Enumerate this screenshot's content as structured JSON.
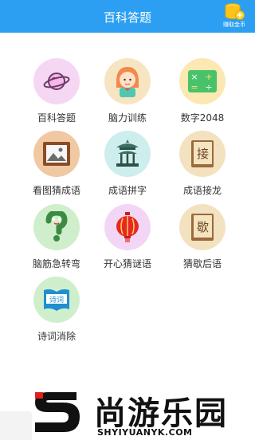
{
  "header": {
    "title": "百科答题",
    "earn_label": "赚取金币"
  },
  "games": [
    {
      "label": "百科答题",
      "icon": "planet-icon",
      "bg": "#f6d7f3"
    },
    {
      "label": "脑力训练",
      "icon": "girl-avatar-icon",
      "bg": "#f7e5c2"
    },
    {
      "label": "数字2048",
      "icon": "math-symbols-icon",
      "bg": "#fbe8b2"
    },
    {
      "label": "看图猜成语",
      "icon": "picture-frame-icon",
      "bg": "#f0c8a2"
    },
    {
      "label": "成语拼字",
      "icon": "pavilion-icon",
      "bg": "#cdeeed"
    },
    {
      "label": "成语接龙",
      "icon": "book-jie-icon",
      "bg": "#f3e2bf"
    },
    {
      "label": "脑筋急转弯",
      "icon": "question-mark-icon",
      "bg": "#cfefcc"
    },
    {
      "label": "开心猜谜语",
      "icon": "lantern-icon",
      "bg": "#f3d6f5"
    },
    {
      "label": "猜歇后语",
      "icon": "book-xie-icon",
      "bg": "#f3e2bf"
    },
    {
      "label": "诗词消除",
      "icon": "poem-book-icon",
      "bg": "#cfefcc"
    }
  ],
  "icon_text": {
    "jie": "接",
    "xie": "歇",
    "poem": "诗词"
  },
  "watermark": {
    "text": "尚游乐园",
    "url": "SHYIYUANYK.COM"
  }
}
